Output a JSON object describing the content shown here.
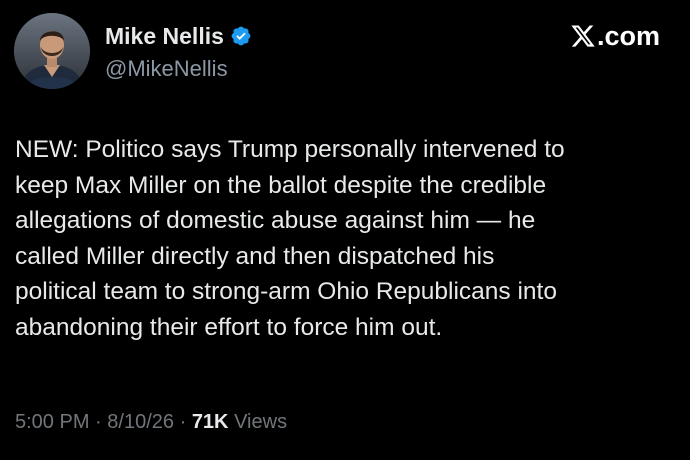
{
  "author": {
    "display_name": "Mike Nellis",
    "handle": "@MikeNellis",
    "verified_icon": "verified-badge-icon",
    "verified_color": "#1d9bf0"
  },
  "brand": {
    "icon": "x-logo-icon",
    "label": ".com"
  },
  "tweet": {
    "text": "NEW: Politico says Trump personally intervened to\nkeep Max Miller on the ballot despite the credible\nallegations of domestic abuse against him — he\ncalled Miller directly and then dispatched his\npolitical team to strong-arm Ohio Republicans into\nabandoning their effort to force him out."
  },
  "meta": {
    "time": "5:00 PM",
    "separator": "·",
    "date": "8/10/26",
    "views_count": "71K",
    "views_label": "Views"
  },
  "colors": {
    "background": "#000000",
    "primary_text": "#e7e9ea",
    "secondary_text": "#71767b"
  }
}
